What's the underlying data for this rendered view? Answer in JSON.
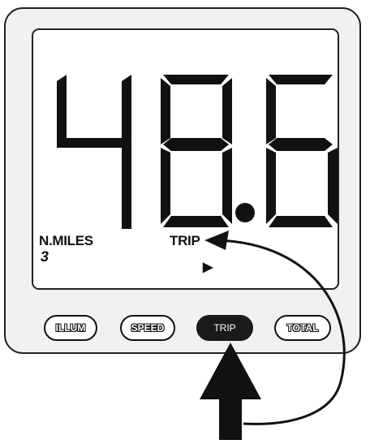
{
  "display": {
    "reading": "48.6",
    "units_label": "N.MILES",
    "mode_label": "TRIP",
    "small_digit": "3",
    "pointer_glyph": "▶"
  },
  "buttons": [
    {
      "label": "ILLUM",
      "style": "outline"
    },
    {
      "label": "SPEED",
      "style": "outline"
    },
    {
      "label": "TRIP",
      "style": "solid",
      "pressed": true
    },
    {
      "label": "TOTAL",
      "style": "outline"
    }
  ],
  "indicators": {
    "press_arrow_icon": "up-arrow-icon",
    "curved_arrow_icon": "curved-arrow-icon"
  },
  "colors": {
    "ink": "#1a1a1a",
    "paper": "#ffffff",
    "bezel": "#e6e6e6"
  }
}
